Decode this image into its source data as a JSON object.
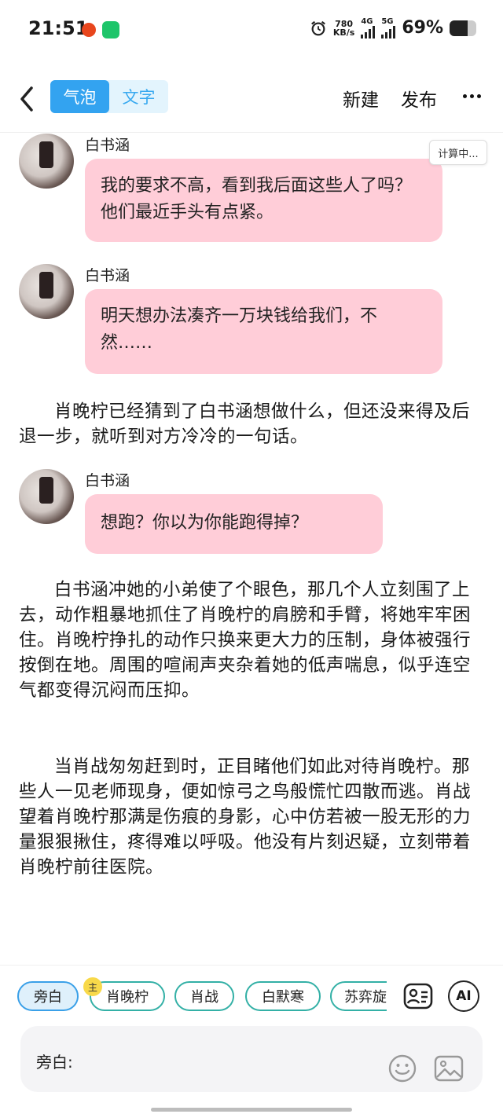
{
  "status_bar": {
    "time": "21:51",
    "speed_value": "780",
    "speed_unit": "KB/s",
    "net1": "4G",
    "net2": "5G",
    "battery_pct": "69%",
    "battery_level": 0.69
  },
  "header": {
    "tabs": [
      {
        "label": "气泡",
        "active": true
      },
      {
        "label": "文字",
        "active": false
      }
    ],
    "new_label": "新建",
    "publish_label": "发布"
  },
  "calc_badge": "计算中...",
  "messages": [
    {
      "speaker": "白书涵",
      "text": "我的要求不高，看到我后面这些人了吗？他们最近手头有点紧。"
    },
    {
      "speaker": "白书涵",
      "text": "明天想办法凑齐一万块钱给我们，不然……"
    },
    {
      "speaker": "白书涵",
      "text": "想跑？你以为你能跑得掉？"
    }
  ],
  "narration": [
    "肖晚柠已经猜到了白书涵想做什么，但还没来得及后退一步，就听到对方冷冷的一句话。",
    "白书涵冲她的小弟使了个眼色，那几个人立刻围了上去，动作粗暴地抓住了肖晚柠的肩膀和手臂，将她牢牢困住。肖晚柠挣扎的动作只换来更大力的压制，身体被强行按倒在地。周围的喧闹声夹杂着她的低声喘息，似乎连空气都变得沉闷而压抑。",
    "当肖战匆匆赶到时，正目睹他们如此对待肖晚柠。那些人一见老师现身，便如惊弓之鸟般慌忙四散而逃。肖战望着肖晚柠那满是伤痕的身影，心中仿若被一股无形的力量狠狠揪住，疼得难以呼吸。他没有片刻迟疑，立刻带着肖晚柠前往医院。"
  ],
  "characters": {
    "chips": [
      "旁白",
      "肖晚柠",
      "肖战",
      "白默寒",
      "苏弈旋"
    ],
    "active_index": 0,
    "main_badge": "主",
    "ai_label": "AI"
  },
  "input": {
    "label": "旁白:"
  }
}
